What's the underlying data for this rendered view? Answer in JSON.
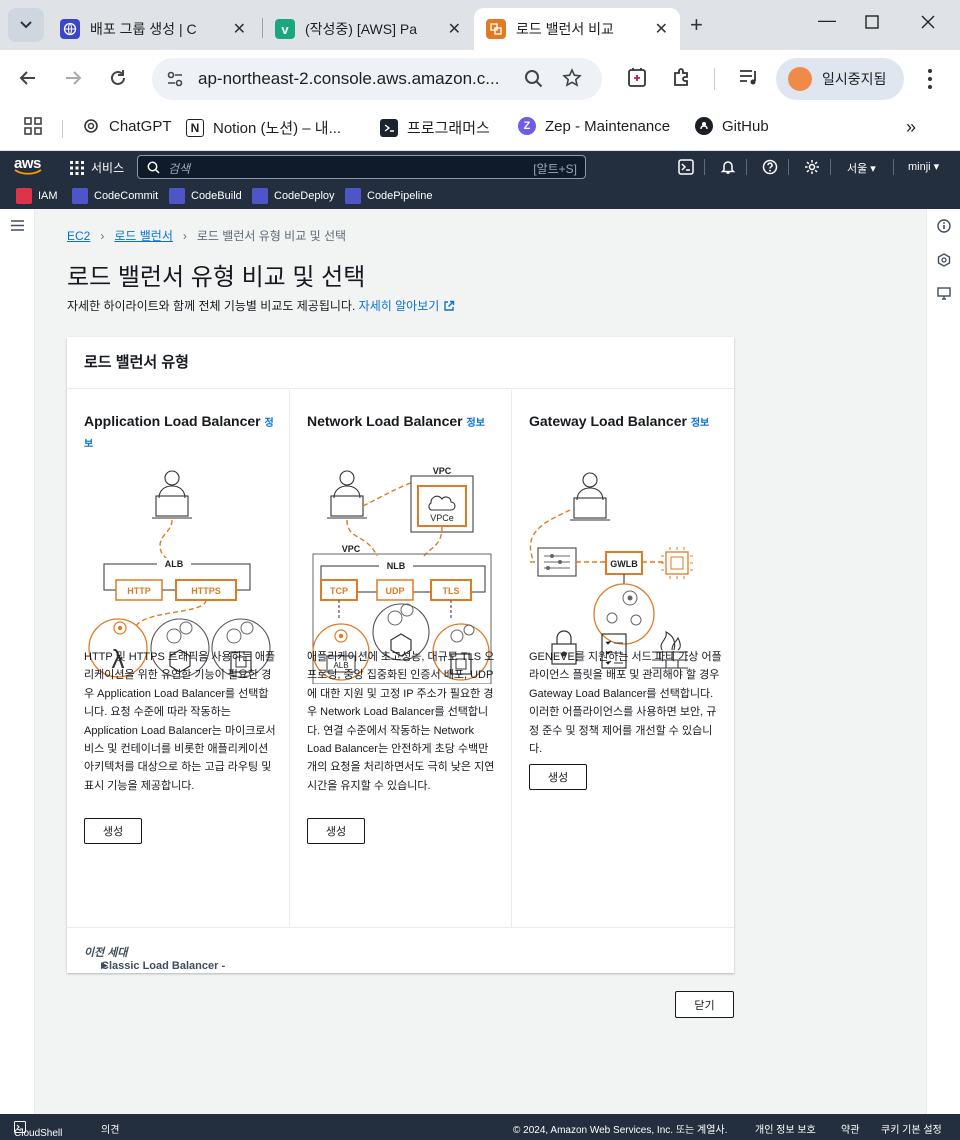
{
  "browser": {
    "tabs": [
      {
        "title": "배포 그룹 생성 | C",
        "active": false
      },
      {
        "title": "(작성중) [AWS] Pa",
        "active": false
      },
      {
        "title": "로드 밸런서 비교",
        "active": true
      }
    ],
    "url": "ap-northeast-2.console.aws.amazon.c...",
    "profile_label": "일시중지됨",
    "bookmarks": [
      {
        "label": "ChatGPT",
        "icon": "chatgpt-icon"
      },
      {
        "label": "Notion (노션) – 내...",
        "icon": "notion-icon"
      },
      {
        "label": "프로그래머스",
        "icon": "programmers-icon"
      },
      {
        "label": "Zep - Maintenance",
        "icon": "zep-icon"
      },
      {
        "label": "GitHub",
        "icon": "github-icon"
      }
    ]
  },
  "aws_header": {
    "logo": "aws",
    "services": "서비스",
    "search_placeholder": "검색",
    "search_shortcut": "[알트+S]",
    "region": "서울 ▾",
    "user": "minji ▾",
    "favorites": [
      "IAM",
      "CodeCommit",
      "CodeBuild",
      "CodeDeploy",
      "CodePipeline"
    ]
  },
  "breadcrumb": {
    "items": [
      "EC2",
      "로드 밸런서"
    ],
    "current": "로드 밸런서 유형 비교 및 선택"
  },
  "page": {
    "title": "로드 밸런서 유형 비교 및 선택",
    "subtitle": "자세한 하이라이트와 함께 전체 기능별 비교도 제공됩니다.",
    "learn_more": "자세히 알아보기"
  },
  "panel": {
    "title": "로드 밸런서 유형",
    "info_label": "정보",
    "create_label": "생성",
    "types": [
      {
        "name": "Application Load Balancer",
        "diagram_labels": {
          "group": "ALB",
          "left": "HTTP",
          "right": "HTTPS"
        },
        "description": "HTTP 및 HTTPS 트래픽을 사용하는 애플리케이션을 위한 유연한 기능이 필요한 경우 Application Load Balancer를 선택합니다. 요청 수준에 따라 작동하는 Application Load Balancer는 마이크로서비스 및 컨테이너를 비롯한 애플리케이션 아키텍처를 대상으로 하는 고급 라우팅 및 표시 기능을 제공합니다."
      },
      {
        "name": "Network Load Balancer",
        "diagram_labels": {
          "vpc": "VPC",
          "vpce": "VPCe",
          "group": "NLB",
          "p1": "TCP",
          "p2": "UDP",
          "p3": "TLS",
          "alb": "ALB"
        },
        "description": "애플리케이션에 초고성능, 대규모 TLS 오프로딩, 중앙 집중화된 인증서 배포, UDP에 대한 지원 및 고정 IP 주소가 필요한 경우 Network Load Balancer를 선택합니다. 연결 수준에서 작동하는 Network Load Balancer는 안전하게 초당 수백만 개의 요청을 처리하면서도 극히 낮은 지연 시간을 유지할 수 있습니다."
      },
      {
        "name": "Gateway Load Balancer",
        "diagram_labels": {
          "group": "GWLB"
        },
        "description": "GENEVE를 지원하는 서드 파티 가상 어플라이언스 플릿을 배포 및 관리해야 할 경우 Gateway Load Balancer를 선택합니다. 이러한 어플라이언스를 사용하면 보안, 규정 준수 및 정책 제어를 개선할 수 있습니다."
      }
    ],
    "classic": {
      "name": "Classic Load Balancer - ",
      "note": "이전 세대"
    },
    "close_label": "닫기"
  },
  "footer": {
    "cloudshell": "CloudShell",
    "feedback": "의견",
    "copyright": "© 2024, Amazon Web Services, Inc. 또는 계열사.",
    "privacy": "개인 정보 보호",
    "terms": "약관",
    "cookies": "쿠키 기본 설정"
  },
  "colors": {
    "accent_orange": "#e07b24",
    "link_blue": "#0972d3",
    "aws_navy": "#232f3e"
  }
}
